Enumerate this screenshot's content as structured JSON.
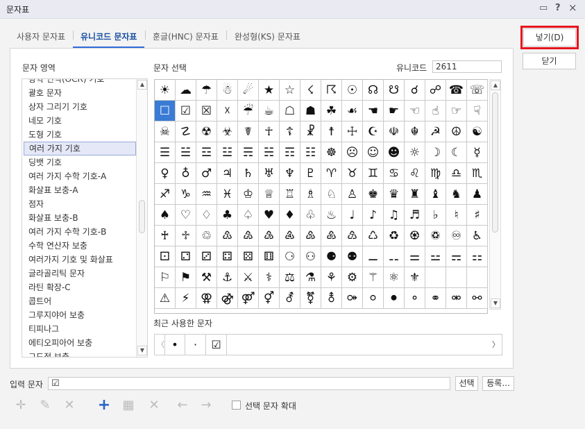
{
  "window": {
    "title": "문자표",
    "icons": [
      "comment-icon",
      "help-icon",
      "close-icon"
    ],
    "help": "?",
    "close": "×",
    "comment": "▭"
  },
  "tabs": [
    "사용자 문자표",
    "유니코드 문자표",
    "훈글(HNC) 문자표",
    "완성형(KS) 문자표"
  ],
  "active_tab": 1,
  "buttons": {
    "insert": "넣기(D)",
    "close": "닫기",
    "select": "선택",
    "register": "등록..."
  },
  "area": {
    "label": "문자 영역",
    "items": [
      "광학 인식(OCR) 기호",
      "괄호 문자",
      "상자 그리기 기호",
      "네모 기호",
      "도형 기호",
      "여러 가지 기호",
      "딩뱃 기호",
      "여러 가지 수학 기호-A",
      "화살표 보충-A",
      "점자",
      "화살표 보충-B",
      "여러 가지 수학 기호-B",
      "수학 연산자 보충",
      "여러가지 기호 및 화살표",
      "글라골리틱 문자",
      "라틴 확장-C",
      "콥트어",
      "그루지야어 보충",
      "티피나그",
      "에티오피아어 보충",
      "그드적 보충"
    ],
    "selected": 5
  },
  "chars": {
    "label": "문자 선택",
    "unicode_label": "유니코드",
    "unicode_value": "2611",
    "selected_index": 16,
    "rows": [
      [
        "☀",
        "☁",
        "☂",
        "☃",
        "☄",
        "★",
        "☆",
        "☇",
        "☈",
        "☉",
        "☊",
        "☋",
        "☌",
        "☍",
        "☎",
        "☏"
      ],
      [
        "☐",
        "☑",
        "☒",
        "☓",
        "☔",
        "☕",
        "☖",
        "☗",
        "☘",
        "☙",
        "☚",
        "☛",
        "☜",
        "☝",
        "☞",
        "☟"
      ],
      [
        "☠",
        "☡",
        "☢",
        "☣",
        "☤",
        "☥",
        "☦",
        "☧",
        "☨",
        "☩",
        "☪",
        "☫",
        "☬",
        "☭",
        "☮",
        "☯"
      ],
      [
        "☰",
        "☱",
        "☲",
        "☳",
        "☴",
        "☵",
        "☶",
        "☷",
        "☸",
        "☹",
        "☺",
        "☻",
        "☼",
        "☽",
        "☾",
        "☿"
      ],
      [
        "♀",
        "♁",
        "♂",
        "♃",
        "♄",
        "♅",
        "♆",
        "♇",
        "♈",
        "♉",
        "♊",
        "♋",
        "♌",
        "♍",
        "♎",
        "♏"
      ],
      [
        "♐",
        "♑",
        "♒",
        "♓",
        "♔",
        "♕",
        "♖",
        "♗",
        "♘",
        "♙",
        "♚",
        "♛",
        "♜",
        "♝",
        "♞",
        "♟"
      ],
      [
        "♠",
        "♡",
        "♢",
        "♣",
        "♤",
        "♥",
        "♦",
        "♧",
        "♨",
        "♩",
        "♪",
        "♫",
        "♬",
        "♭",
        "♮",
        "♯"
      ],
      [
        "♰",
        "♱",
        "♲",
        "♳",
        "♴",
        "♵",
        "♶",
        "♷",
        "♸",
        "♹",
        "♺",
        "♻",
        "♼",
        "♽",
        "♾",
        "♿"
      ],
      [
        "⚀",
        "⚁",
        "⚂",
        "⚃",
        "⚄",
        "⚅",
        "⚆",
        "⚇",
        "⚈",
        "⚉",
        "⚊",
        "⚋",
        "⚌",
        "⚍",
        "⚎",
        "⚏"
      ],
      [
        "⚐",
        "⚑",
        "⚒",
        "⚓",
        "⚔",
        "⚕",
        "⚖",
        "⚗",
        "⚘",
        "⚙",
        "⚚",
        "⚛",
        "⚜",
        "",
        "",
        ""
      ],
      [
        "⚠",
        "⚡",
        "⚢",
        "⚣",
        "⚤",
        "⚥",
        "⚦",
        "⚧",
        "⚨",
        "⚩",
        "⚪",
        "⚫",
        "⚬",
        "⚭",
        "⚮",
        "⚯"
      ]
    ]
  },
  "recent": {
    "label": "최근 사용한 문자",
    "items": [
      "•",
      "·",
      "☑"
    ],
    "prev": "〈",
    "next": "〉"
  },
  "input": {
    "label": "입력 문자",
    "value": "☑"
  },
  "toolbar": {
    "enlarge_label": "선택 문자 확대",
    "tools": [
      "✛",
      "✎",
      "✕",
      "+",
      "▦",
      "✕",
      "←",
      "→"
    ]
  },
  "colors": {
    "accent": "#2e6bd8",
    "highlight": "#e8131c",
    "selected": "#3a7bd5"
  }
}
